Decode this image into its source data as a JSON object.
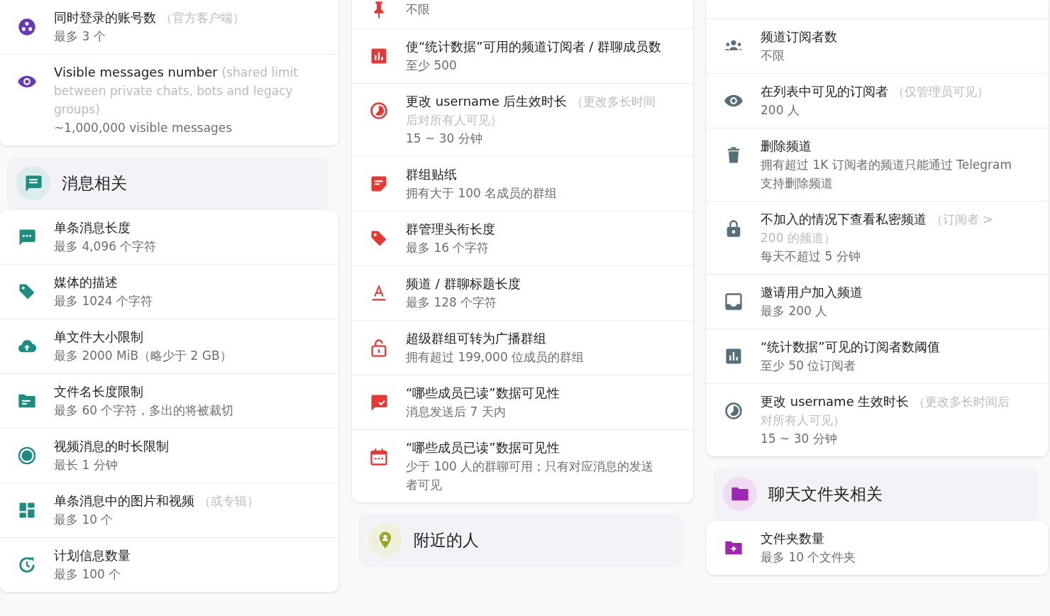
{
  "columns": [
    {
      "blocks": [
        {
          "kind": "card",
          "color": "#673ab7",
          "items": [
            {
              "title": "同时登录的账号数",
              "note": "（官方客户端）",
              "value": "最多 3 个"
            },
            {
              "title": "Visible messages number",
              "note": "(shared limit between private chats, bots and legacy groups)",
              "value": "~1,000,000 visible messages"
            }
          ]
        },
        {
          "kind": "section",
          "color": "#1e8c80",
          "title": "消息相关"
        },
        {
          "kind": "card",
          "color": "#1e8c80",
          "items": [
            {
              "title": "单条消息长度",
              "value": "最多 4,096 个字符"
            },
            {
              "title": "媒体的描述",
              "value": "最多 1024 个字符"
            },
            {
              "title": "单文件大小限制",
              "value": "最多 2000 MiB（略少于 2 GB）"
            },
            {
              "title": "文件名长度限制",
              "value": "最多 60 个字符，多出的将被裁切"
            },
            {
              "title": "视频消息的时长限制",
              "value": "最长 1 分钟"
            },
            {
              "title": "单条消息中的图片和视频",
              "note": "（或专辑）",
              "value": "最多 10 个"
            },
            {
              "title": "计划信息数量",
              "value": "最多 100 个"
            }
          ]
        }
      ]
    },
    {
      "blocks": [
        {
          "kind": "card",
          "color": "#e53935",
          "items": [
            {
              "value": "不限"
            },
            {
              "title": "使“统计数据”可用的频道订阅者 / 群聊成员数",
              "value": "至少 500"
            },
            {
              "title": "更改 username 后生效时长",
              "note": "（更改多长时间后对所有人可见）",
              "value": "15 ~ 30 分钟"
            },
            {
              "title": "群组贴纸",
              "value": "拥有大于 100 名成员的群组"
            },
            {
              "title": "群管理头衔长度",
              "value": "最多 16 个字符"
            },
            {
              "title": "频道 / 群聊标题长度",
              "value": "最多 128 个字符"
            },
            {
              "title": "超级群组可转为广播群组",
              "value": "拥有超过 199,000 位成员的群组"
            },
            {
              "title": "“哪些成员已读”数据可见性",
              "value": "消息发送后 7 天内"
            },
            {
              "title": "“哪些成员已读”数据可见性",
              "value": "少于 100 人的群聊可用；只有对应消息的发送者可见"
            }
          ]
        },
        {
          "kind": "section",
          "color": "#9ea526",
          "title": "附近的人"
        }
      ]
    },
    {
      "blocks": [
        {
          "kind": "card",
          "color": "#546e7a",
          "items": [
            {
              "title": "频道订阅者数",
              "value": "不限"
            },
            {
              "title": "在列表中可见的订阅者",
              "note": "（仅管理员可见）",
              "value": "200 人"
            },
            {
              "title": "删除频道",
              "value": "拥有超过 1K 订阅者的频道只能通过 Telegram 支持删除频道"
            },
            {
              "title": "不加入的情况下查看私密频道",
              "note": "（订阅者 > 200 的频道）",
              "value": "每天不超过 5 分钟"
            },
            {
              "title": "邀请用户加入频道",
              "value": "最多 200 人"
            },
            {
              "title": "“统计数据”可见的订阅者数阈值",
              "value": "至少 50 位订阅者"
            },
            {
              "title": "更改 username 生效时长",
              "note": "（更改多长时间后对所有人可见）",
              "value": "15 ~ 30 分钟"
            }
          ]
        },
        {
          "kind": "section",
          "color": "#9c27b0",
          "title": "聊天文件夹相关"
        },
        {
          "kind": "card",
          "color": "#9c27b0",
          "items": [
            {
              "title": "文件夹数量",
              "value": "最多 10 个文件夹"
            }
          ]
        }
      ]
    }
  ]
}
